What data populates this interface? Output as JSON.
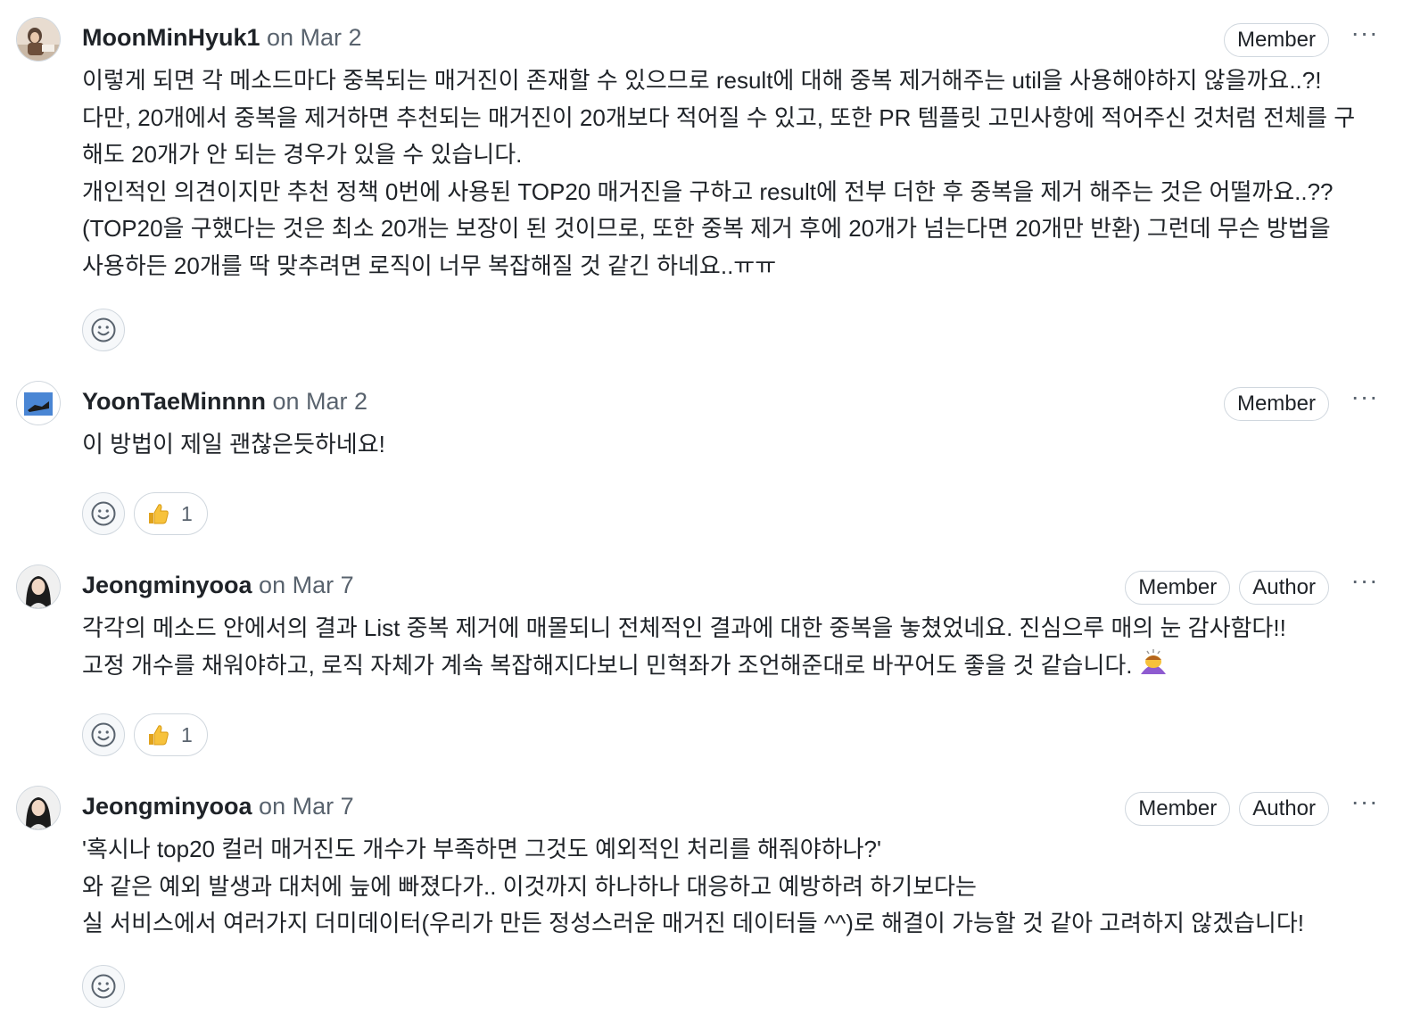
{
  "comments": [
    {
      "author": "MoonMinHyuk1",
      "date": "on Mar 2",
      "badges": [
        "Member"
      ],
      "menu": "···",
      "lines": [
        "이렇게 되면 각 메소드마다 중복되는 매거진이 존재할 수 있으므로 result에 대해 중복 제거해주는 util을 사용해야하지 않을까요..?!",
        "다만, 20개에서 중복을 제거하면 추천되는 매거진이 20개보다 적어질 수 있고, 또한 PR 템플릿 고민사항에 적어주신 것처럼 전체를 구",
        "해도 20개가 안 되는 경우가 있을 수 있습니다.",
        "개인적인 의견이지만 추천 정책 0번에 사용된 TOP20 매거진을 구하고 result에 전부 더한 후 중복을 제거 해주는 것은 어떨까요..??",
        "(TOP20을 구했다는 것은 최소 20개는 보장이 된 것이므로, 또한 중복 제거 후에 20개가 넘는다면 20개만 반환) 그런데 무슨 방법을",
        "사용하든 20개를 딱 맞추려면 로직이 너무 복잡해질 것 같긴 하네요..ㅠㅠ"
      ],
      "reactions": []
    },
    {
      "author": "YoonTaeMinnnn",
      "date": "on Mar 2",
      "badges": [
        "Member"
      ],
      "menu": "···",
      "lines": [
        "이 방법이 제일 괜찮은듯하네요!"
      ],
      "reactions": [
        {
          "emoji": "thumbs-up",
          "count": "1"
        }
      ]
    },
    {
      "author": "Jeongminyooa",
      "date": "on Mar 7",
      "badges": [
        "Member",
        "Author"
      ],
      "menu": "···",
      "lines": [
        "각각의 메소드 안에서의 결과 List 중복 제거에 매몰되니 전체적인 결과에 대한 중복을 놓쳤었네요. 진심으루 매의 눈 감사함다!!",
        "고정 개수를 채워야하고, 로직 자체가 계속 복잡해지다보니 민혁좌가 조언해준대로 바꾸어도 좋을 것 같습니다."
      ],
      "reactions": [
        {
          "emoji": "thumbs-up",
          "count": "1"
        }
      ]
    },
    {
      "author": "Jeongminyooa",
      "date": "on Mar 7",
      "badges": [
        "Member",
        "Author"
      ],
      "menu": "···",
      "lines": [
        "'혹시나 top20 컬러 매거진도 개수가 부족하면 그것도 예외적인 처리를 해줘야하나?'",
        "와 같은 예외 발생과 대처에 늪에 빠졌다가.. 이것까지 하나하나 대응하고 예방하려 하기보다는",
        "실 서비스에서 여러가지 더미데이터(우리가 만든 정성스러운 매거진 데이터들 ^^)로 해결이 가능할 것 같아 고려하지 않겠습니다!"
      ],
      "reactions": []
    }
  ]
}
